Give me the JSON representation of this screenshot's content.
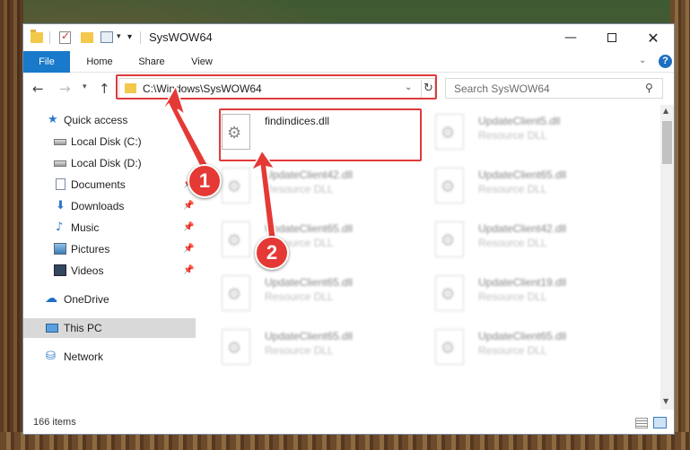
{
  "window": {
    "title": "SysWOW64",
    "controls": {
      "minimize": "—",
      "maximize": "",
      "close": "✕"
    }
  },
  "ribbon": {
    "tabs": [
      "File",
      "Home",
      "Share",
      "View"
    ],
    "help": "?"
  },
  "address": {
    "path": "C:\\Windows\\SysWOW64",
    "search_placeholder": "Search SysWOW64"
  },
  "sidebar": {
    "items": [
      {
        "label": "Quick access",
        "icon": "star-icon",
        "pinned": false
      },
      {
        "label": "Local Disk (C:)",
        "icon": "disk-icon",
        "pinned": false
      },
      {
        "label": "Local Disk (D:)",
        "icon": "disk-icon",
        "pinned": false
      },
      {
        "label": "Documents",
        "icon": "documents-icon",
        "pinned": true
      },
      {
        "label": "Downloads",
        "icon": "download-icon",
        "pinned": true
      },
      {
        "label": "Music",
        "icon": "music-icon",
        "pinned": true
      },
      {
        "label": "Pictures",
        "icon": "pictures-icon",
        "pinned": true
      },
      {
        "label": "Videos",
        "icon": "videos-icon",
        "pinned": true
      },
      {
        "label": "OneDrive",
        "icon": "onedrive-icon",
        "pinned": false
      },
      {
        "label": "This PC",
        "icon": "pc-icon",
        "pinned": false,
        "selected": true
      },
      {
        "label": "Network",
        "icon": "network-icon",
        "pinned": false
      }
    ]
  },
  "files": [
    {
      "name": "findindices.dll",
      "type": ""
    },
    {
      "name": "UpdateClient5.dll",
      "type": "Resource DLL"
    },
    {
      "name": "UpdateClient42.dll",
      "type": "Resource DLL"
    },
    {
      "name": "UpdateClient65.dll",
      "type": "Resource DLL"
    },
    {
      "name": "UpdateClient65.dll",
      "type": "Resource DLL"
    },
    {
      "name": "UpdateClient42.dll",
      "type": "Resource DLL"
    },
    {
      "name": "UpdateClient65.dll",
      "type": "Resource DLL"
    },
    {
      "name": "UpdateClient19.dll",
      "type": "Resource DLL"
    },
    {
      "name": "UpdateClient65.dll",
      "type": "Resource DLL"
    },
    {
      "name": "UpdateClient65.dll",
      "type": "Resource DLL"
    }
  ],
  "status": {
    "items": "166 items"
  },
  "annotations": {
    "step1": "1",
    "step2": "2",
    "color": "#e53935"
  }
}
